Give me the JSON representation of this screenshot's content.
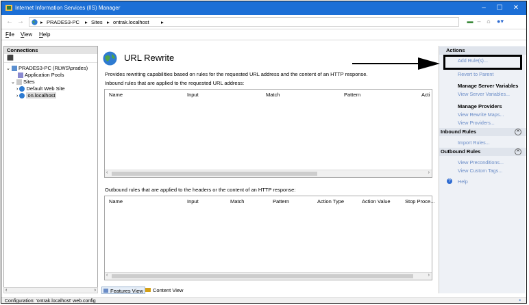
{
  "window": {
    "title": "Internet Information Services (IIS) Manager",
    "controls": {
      "minimize": "–",
      "maximize": "☐",
      "close": "✕"
    }
  },
  "address": {
    "crumbs": [
      "PRADES3-PC",
      "Sites",
      "ontrak.localhost"
    ],
    "separator": "▸"
  },
  "menu": {
    "items": [
      {
        "label": "File",
        "accel": "F",
        "rest": "ile"
      },
      {
        "label": "View",
        "accel": "V",
        "rest": "iew"
      },
      {
        "label": "Help",
        "accel": "H",
        "rest": "elp"
      }
    ]
  },
  "connections": {
    "header": "Connections",
    "tree": {
      "server": "PRADES3-PC (RLWS\\prades)",
      "app_pools": "Application Pools",
      "sites": "Sites",
      "default_site": "Default Web Site",
      "selected_site": "on.localhost"
    }
  },
  "main": {
    "title": "URL Rewrite",
    "description": "Provides rewriting capabilities based on rules for the requested URL address and the content of an HTTP response.",
    "inbound_label": "Inbound rules that are applied to the requested URL address:",
    "inbound_columns": [
      "Name",
      "Input",
      "Match",
      "Pattern",
      "Acti"
    ],
    "outbound_label": "Outbound rules that are applied to the headers or the content of an HTTP response:",
    "outbound_columns": [
      "Name",
      "Input",
      "Match",
      "Pattern",
      "Action Type",
      "Action Value",
      "Stop Proce..."
    ],
    "features_view": "Features View",
    "content_view": "Content View"
  },
  "actions": {
    "header": "Actions",
    "add_rule": "Add Rule(s)...",
    "revert": "Revert to Parent",
    "manage_server_vars": "Manage Server Variables",
    "view_server_vars": "View Server Variables...",
    "manage_providers": "Manage Providers",
    "view_rewrite_maps": "View Rewrite Maps...",
    "view_providers": "View Providers...",
    "inbound_rules": "Inbound Rules",
    "import_rules": "Import Rules...",
    "outbound_rules": "Outbound Rules",
    "view_preconditions": "View Preconditions...",
    "view_custom_tags": "View Custom Tags...",
    "help": "Help"
  },
  "status": {
    "text": "Configuration: 'ontrak.localhost' web.config"
  },
  "colors": {
    "titlebar": "#1c6fd6",
    "link": "#6a8cc7",
    "actions_bg": "#eef1f6"
  }
}
